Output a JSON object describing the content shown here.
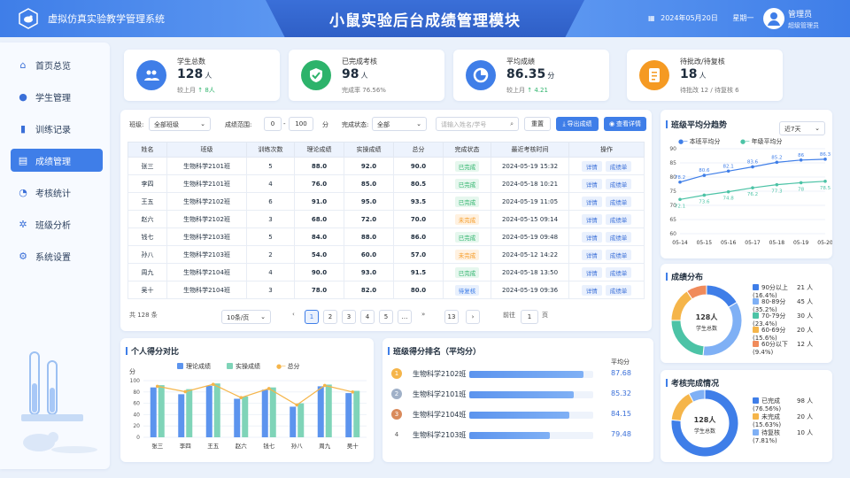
{
  "header": {
    "system_name": "虚拟仿真实验教学管理系统",
    "title": "小鼠实验后台成绩管理模块",
    "date": "2024年05月20日",
    "weekday": "星期一",
    "admin_name": "管理员",
    "admin_role": "超级管理员"
  },
  "sidebar": {
    "items": [
      {
        "label": "首页总览",
        "icon": "home-icon"
      },
      {
        "label": "学生管理",
        "icon": "user-icon"
      },
      {
        "label": "训练记录",
        "icon": "bar-chart-icon"
      },
      {
        "label": "成绩管理",
        "icon": "grades-icon",
        "active": true
      },
      {
        "label": "考核统计",
        "icon": "pie-chart-icon"
      },
      {
        "label": "班级分析",
        "icon": "settings-icon"
      },
      {
        "label": "系统设置",
        "icon": "gear-icon"
      }
    ]
  },
  "kpis": [
    {
      "label": "学生总数",
      "value": "128",
      "unit": "人",
      "sub_prefix": "较上月",
      "sub_value": "↑ 8人",
      "color": "#3f7ee8",
      "icon": "users-icon"
    },
    {
      "label": "已完成考核",
      "value": "98",
      "unit": "人",
      "sub_prefix": "完成率",
      "sub_value": "76.56%",
      "color": "#2db36b",
      "icon": "check-shield-icon"
    },
    {
      "label": "平均成绩",
      "value": "86.35",
      "unit": "分",
      "sub_prefix": "较上月",
      "sub_value": "↑ 4.21",
      "color": "#3f7ee8",
      "icon": "chart-icon"
    },
    {
      "label": "待批改/待复核",
      "value": "18",
      "unit": "人",
      "sub_prefix": "待批改 12 / 待复核 6",
      "sub_value": "",
      "color": "#f59a23",
      "icon": "document-icon"
    }
  ],
  "filters": {
    "class_label": "班级:",
    "class_value": "全部班级",
    "range_label": "成绩范围:",
    "range_min": "0",
    "range_max": "100",
    "range_unit": "分",
    "status_label": "完成状态:",
    "status_value": "全部",
    "search_placeholder": "请输入姓名/学号",
    "reset": "重置",
    "export": "导出成绩",
    "view": "查看详情"
  },
  "table": {
    "headers": [
      "姓名",
      "班级",
      "训练次数",
      "理论成绩",
      "实操成绩",
      "总分",
      "完成状态",
      "最近考核时间",
      "操作"
    ],
    "rows": [
      {
        "name": "张三",
        "class": "生物科学2101班",
        "count": "5",
        "theory": "88.0",
        "practice": "92.0",
        "total": "90.0",
        "status": "已完成",
        "time": "2024-05-19 15:32"
      },
      {
        "name": "李四",
        "class": "生物科学2101班",
        "count": "4",
        "theory": "76.0",
        "practice": "85.0",
        "total": "80.5",
        "status": "已完成",
        "time": "2024-05-18 10:21"
      },
      {
        "name": "王五",
        "class": "生物科学2102班",
        "count": "6",
        "theory": "91.0",
        "practice": "95.0",
        "total": "93.5",
        "status": "已完成",
        "time": "2024-05-19 11:05"
      },
      {
        "name": "赵六",
        "class": "生物科学2102班",
        "count": "3",
        "theory": "68.0",
        "practice": "72.0",
        "total": "70.0",
        "status": "未完成",
        "time": "2024-05-15 09:14"
      },
      {
        "name": "钱七",
        "class": "生物科学2103班",
        "count": "5",
        "theory": "84.0",
        "practice": "88.0",
        "total": "86.0",
        "status": "已完成",
        "time": "2024-05-19 09:48"
      },
      {
        "name": "孙八",
        "class": "生物科学2103班",
        "count": "2",
        "theory": "54.0",
        "practice": "60.0",
        "total": "57.0",
        "status": "未完成",
        "time": "2024-05-12 14:22"
      },
      {
        "name": "周九",
        "class": "生物科学2104班",
        "count": "4",
        "theory": "90.0",
        "practice": "93.0",
        "total": "91.5",
        "status": "已完成",
        "time": "2024-05-18 13:50"
      },
      {
        "name": "吴十",
        "class": "生物科学2104班",
        "count": "3",
        "theory": "78.0",
        "practice": "82.0",
        "total": "80.0",
        "status": "待复核",
        "time": "2024-05-19 09:36"
      }
    ],
    "op_detail": "详情",
    "op_grade": "成绩单"
  },
  "pagination": {
    "total": "共 128 条",
    "page_size": "10条/页",
    "pages": [
      "1",
      "2",
      "3",
      "4",
      "5",
      "…",
      "13"
    ],
    "goto_label": "前往",
    "goto_value": "1",
    "goto_suffix": "页"
  },
  "colors": {
    "primary": "#3f7ee8",
    "green": "#2db36b",
    "orange": "#f59a23",
    "teal": "#4cc3a6",
    "done_bg": "#e6f7ee",
    "todo_bg": "#fff1e0",
    "review_bg": "#e8f0fd"
  },
  "personal_chart": {
    "title": "个人得分对比",
    "legend": [
      "理论成绩",
      "实操成绩",
      "总分"
    ],
    "y_unit": "分"
  },
  "ranking": {
    "title": "班级得分排名（平均分）",
    "value_header": "平均分",
    "items": [
      {
        "rank": "1",
        "name": "生物科学2102班",
        "value": "87.68",
        "score": 87.68
      },
      {
        "rank": "2",
        "name": "生物科学2101班",
        "value": "85.32",
        "score": 85.32
      },
      {
        "rank": "3",
        "name": "生物科学2104班",
        "value": "84.15",
        "score": 84.15
      },
      {
        "rank": "4",
        "name": "生物科学2103班",
        "value": "79.48",
        "score": 79.48
      }
    ]
  },
  "trend": {
    "title": "班级平均分趋势",
    "period": "近7天",
    "legend": [
      "本班平均分",
      "年级平均分"
    ]
  },
  "distribution": {
    "title": "成绩分布",
    "center_value": "128人",
    "center_label": "学生总数",
    "items": [
      {
        "label": "90分以上",
        "count": "21 人",
        "pct": "(16.4%)",
        "color": "#3f7ee8",
        "value": 16.4
      },
      {
        "label": "80-89分",
        "count": "45 人",
        "pct": "(35.2%)",
        "color": "#7fb0f5",
        "value": 35.2
      },
      {
        "label": "70-79分",
        "count": "30 人",
        "pct": "(23.4%)",
        "color": "#4cc3a6",
        "value": 23.4
      },
      {
        "label": "60-69分",
        "count": "20 人",
        "pct": "(15.6%)",
        "color": "#f5b54a",
        "value": 15.6
      },
      {
        "label": "60分以下",
        "count": "12 人",
        "pct": "(9.4%)",
        "color": "#f08b5b",
        "value": 9.4
      }
    ]
  },
  "completion": {
    "title": "考核完成情况",
    "center_value": "128人",
    "center_label": "学生总数",
    "items": [
      {
        "label": "已完成",
        "count": "98 人",
        "pct": "(76.56%)",
        "color": "#3f7ee8",
        "value": 76.56
      },
      {
        "label": "未完成",
        "count": "20 人",
        "pct": "(15.63%)",
        "color": "#f5b54a",
        "value": 15.63
      },
      {
        "label": "待复核",
        "count": "10 人",
        "pct": "(7.81%)",
        "color": "#7fb0f5",
        "value": 7.81
      }
    ]
  },
  "chart_data": [
    {
      "type": "bar",
      "title": "个人得分对比",
      "categories": [
        "张三",
        "李四",
        "王五",
        "赵六",
        "钱七",
        "孙八",
        "周九",
        "吴十"
      ],
      "series": [
        {
          "name": "理论成绩",
          "type": "bar",
          "values": [
            88,
            76,
            91,
            68,
            84,
            54,
            90,
            78
          ]
        },
        {
          "name": "实操成绩",
          "type": "bar",
          "values": [
            92,
            85,
            95,
            72,
            88,
            60,
            93,
            82
          ]
        },
        {
          "name": "总分",
          "type": "line",
          "values": [
            90,
            80.5,
            93.5,
            70,
            86,
            57,
            91.5,
            80
          ]
        }
      ],
      "ylabel": "分",
      "ylim": [
        0,
        100
      ],
      "yticks": [
        0,
        20,
        40,
        60,
        80,
        100
      ]
    },
    {
      "type": "line",
      "title": "班级平均分趋势",
      "x": [
        "05-14",
        "05-15",
        "05-16",
        "05-17",
        "05-18",
        "05-19",
        "05-20"
      ],
      "series": [
        {
          "name": "本班平均分",
          "values": [
            78.2,
            80.6,
            82.1,
            83.6,
            85.2,
            86.0,
            86.3
          ]
        },
        {
          "name": "年级平均分",
          "values": [
            72.1,
            73.6,
            74.8,
            76.2,
            77.3,
            78.0,
            78.5
          ]
        }
      ],
      "ylim": [
        60,
        90
      ],
      "yticks": [
        60,
        65,
        70,
        75,
        80,
        85,
        90
      ]
    }
  ]
}
